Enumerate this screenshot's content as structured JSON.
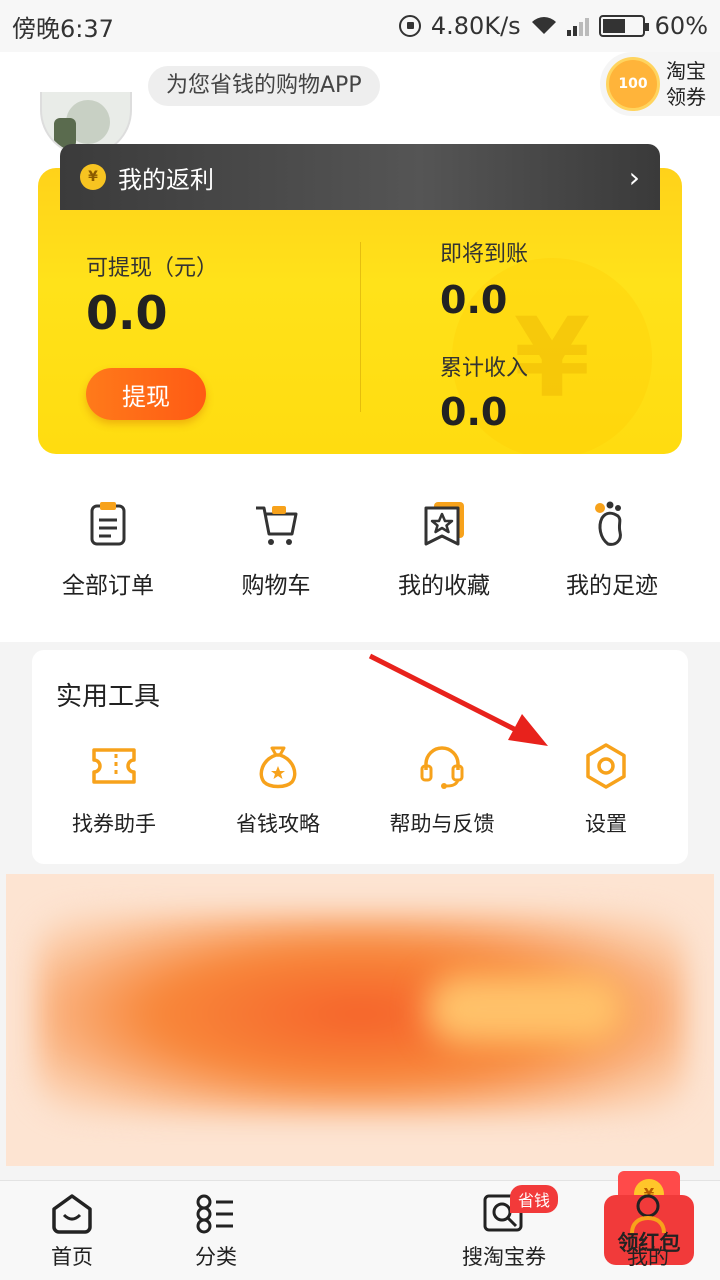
{
  "status_bar": {
    "time": "傍晚6:37",
    "speed": "4.80K/s",
    "battery": "60%",
    "battery_level": 0.6
  },
  "header": {
    "slogan": "为您省钱的购物APP",
    "coupon_badge": "100",
    "coupon_label": "淘宝领券"
  },
  "rebate": {
    "title": "我的返利",
    "withdrawable_label": "可提现（元）",
    "withdrawable_value": "0.0",
    "withdraw_button": "提现",
    "pending_label": "即将到账",
    "pending_value": "0.0",
    "total_label": "累计收入",
    "total_value": "0.0",
    "coin_symbol": "¥"
  },
  "quick": [
    {
      "label": "全部订单",
      "icon": "order-icon"
    },
    {
      "label": "购物车",
      "icon": "cart-icon"
    },
    {
      "label": "我的收藏",
      "icon": "favorite-icon"
    },
    {
      "label": "我的足迹",
      "icon": "footprint-icon"
    }
  ],
  "tools": {
    "title": "实用工具",
    "items": [
      {
        "label": "找券助手",
        "icon": "ticket-icon"
      },
      {
        "label": "省钱攻略",
        "icon": "money-bag-icon"
      },
      {
        "label": "帮助与反馈",
        "icon": "headset-icon"
      },
      {
        "label": "设置",
        "icon": "settings-icon"
      }
    ]
  },
  "bottom_nav": [
    {
      "label": "首页",
      "icon": "home-icon"
    },
    {
      "label": "分类",
      "icon": "category-icon"
    },
    {
      "label": "领红包",
      "icon": "red-packet-icon"
    },
    {
      "label": "搜淘宝券",
      "icon": "search-coupon-icon",
      "badge": "省钱"
    },
    {
      "label": "我的",
      "icon": "profile-icon"
    }
  ],
  "colors": {
    "accent": "#f7a21b",
    "yellow": "#ffdc10",
    "orange_button": "#ff6a1a",
    "arrow": "#e8221c"
  }
}
